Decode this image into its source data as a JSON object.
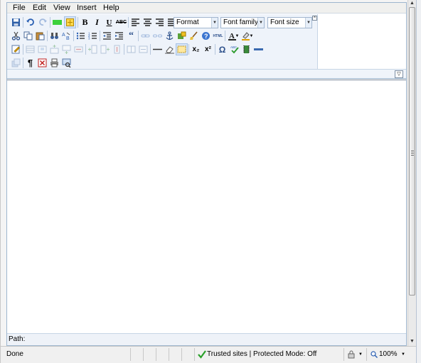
{
  "menu": {
    "file": "File",
    "edit": "Edit",
    "view": "View",
    "insert": "Insert",
    "help": "Help"
  },
  "toolbar": {
    "format_select": "Format",
    "font_family_select": "Font family",
    "font_size_select": "Font size",
    "bold": "B",
    "italic": "I",
    "underline": "U",
    "strikethrough": "ABC",
    "quote": "“",
    "html": "HTML",
    "subscript": "x₂",
    "superscript": "x²",
    "special_char": "Ω",
    "pilcrow": "¶"
  },
  "path": {
    "label": "Path:"
  },
  "status": {
    "left": "Done",
    "security": "Trusted sites | Protected Mode: Off",
    "zoom": "100%"
  },
  "colors": {
    "toolbar_bg": "#eef3fa",
    "border": "#9eb6ce",
    "accent": "#2b60b3",
    "checkmark": "#2aa02a"
  }
}
